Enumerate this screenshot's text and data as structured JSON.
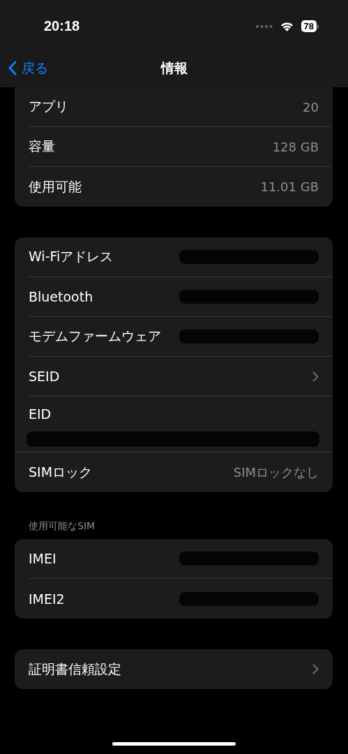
{
  "status_bar": {
    "time": "20:18",
    "battery": "78"
  },
  "nav": {
    "back": "戻る",
    "title": "情報"
  },
  "sections": [
    {
      "clipped_top": true,
      "rows": [
        {
          "kind": "value",
          "label": "アプリ",
          "value": "20"
        },
        {
          "kind": "value",
          "label": "容量",
          "value": "128 GB"
        },
        {
          "kind": "value",
          "label": "使用可能",
          "value": "11.01 GB"
        }
      ]
    },
    {
      "rows": [
        {
          "kind": "redacted",
          "label": "Wi-Fiアドレス"
        },
        {
          "kind": "redacted",
          "label": "Bluetooth"
        },
        {
          "kind": "redacted",
          "label": "モデムファームウェア"
        },
        {
          "kind": "chevron",
          "label": "SEID"
        },
        {
          "kind": "redacted_below",
          "label": "EID"
        },
        {
          "kind": "value",
          "label": "SIMロック",
          "value": "SIMロックなし"
        }
      ]
    },
    {
      "header": "使用可能なSIM",
      "rows": [
        {
          "kind": "redacted",
          "label": "IMEI"
        },
        {
          "kind": "redacted",
          "label": "IMEI2"
        }
      ]
    },
    {
      "rows": [
        {
          "kind": "chevron",
          "label": "証明書信頼設定"
        }
      ]
    }
  ]
}
